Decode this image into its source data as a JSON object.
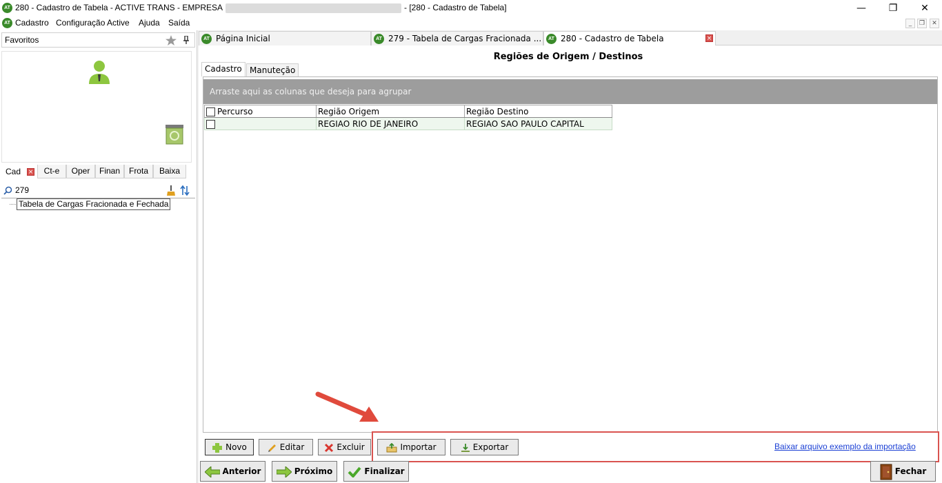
{
  "window": {
    "icon_text": "AT",
    "title_left": "280 - Cadastro de Tabela - ACTIVE TRANS - EMPRESA",
    "title_right": "- [280 - Cadastro de Tabela]",
    "minimize": "—",
    "maximize": "❐",
    "close": "✕"
  },
  "menu": {
    "items": [
      "Cadastro",
      "Configuração Active",
      "Ajuda",
      "Saída"
    ],
    "mdi_minimize": "_",
    "mdi_restore": "❐",
    "mdi_close": "✕"
  },
  "left": {
    "favorites_label": "Favoritos",
    "tabs": [
      "Cad",
      "Ct-e",
      "Oper",
      "Finan",
      "Frota",
      "Baixa"
    ],
    "search_value": "279",
    "tree_item": "Tabela de Cargas Fracionada e Fechada"
  },
  "tabs": [
    {
      "label": "Página Inicial"
    },
    {
      "label": "279 - Tabela de Cargas Fracionada ..."
    },
    {
      "label": "280 - Cadastro de Tabela"
    }
  ],
  "content": {
    "title": "Regiões de Origem / Destinos",
    "subtabs": [
      "Cadastro",
      "Manuteção"
    ],
    "group_hint": "Arraste aqui as colunas que deseja para agrupar",
    "columns": [
      "Percurso",
      "Região Origem",
      "Região Destino"
    ],
    "rows": [
      {
        "percurso": "",
        "origem": "REGIAO RIO DE JANEIRO",
        "destino": "REGIAO SAO PAULO CAPITAL"
      }
    ]
  },
  "buttons": {
    "novo": "Novo",
    "editar": "Editar",
    "excluir": "Excluir",
    "importar": "Importar",
    "exportar": "Exportar",
    "download_link": "Baixar arquivo exemplo da importação",
    "anterior": "Anterior",
    "proximo": "Próximo",
    "finalizar": "Finalizar",
    "fechar": "Fechar"
  },
  "colors": {
    "accent_green": "#3a8a2a",
    "highlight_red": "#d9534f",
    "link_blue": "#1a3fd4",
    "group_bar": "#9d9d9d"
  }
}
